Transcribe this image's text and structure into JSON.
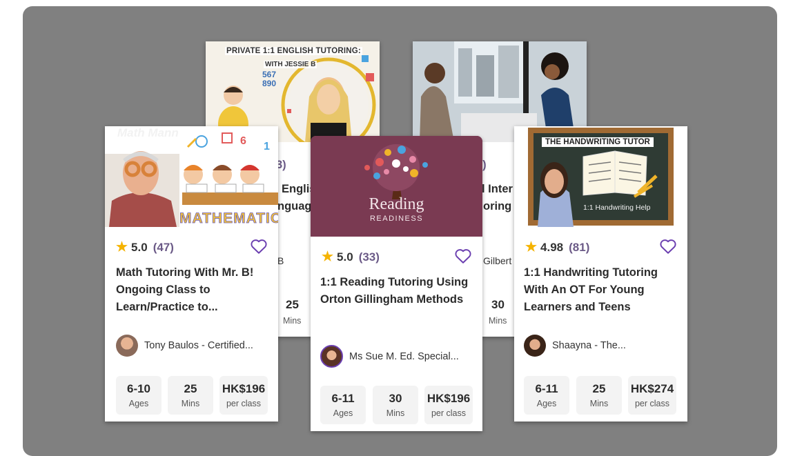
{
  "back_cards": {
    "english": {
      "banner_line1": "PRIVATE 1:1 ENGLISH TUTORING:",
      "banner_line2": "WITH JESSIE B",
      "number_strip": "567\n890",
      "count_fragment": "3)",
      "title_line1": "Englis",
      "title_line2": "nguag",
      "teacher_fragment": "B",
      "mins_value": "25",
      "mins_label": "Mins"
    },
    "interview": {
      "count_fragment": "0)",
      "title_line1": "l Inter",
      "title_line2": "oring",
      "teacher_fragment": "Gilbert",
      "mins_value": "30",
      "mins_label": "Mins"
    }
  },
  "cards": [
    {
      "image_text": "MATHEMATICS",
      "logo_text": "Math Mann",
      "rating": "5.0",
      "reviews": "(47)",
      "title": [
        "Math Tutoring With Mr. B!",
        "Ongoing Class to",
        "Learn/Practice to..."
      ],
      "teacher": "Tony Baulos - Certified...",
      "stats": [
        {
          "value": "6-10",
          "label": "Ages"
        },
        {
          "value": "25",
          "label": "Mins"
        },
        {
          "value": "HK$196",
          "label": "per class"
        }
      ]
    },
    {
      "image_text": "Reading",
      "image_subtext": "READINESS",
      "rating": "5.0",
      "reviews": "(33)",
      "title": [
        "1:1 Reading Tutoring Using",
        "Orton Gillingham Methods"
      ],
      "teacher": "Ms Sue M. Ed. Special...",
      "stats": [
        {
          "value": "6-11",
          "label": "Ages"
        },
        {
          "value": "30",
          "label": "Mins"
        },
        {
          "value": "HK$196",
          "label": "per class"
        }
      ]
    },
    {
      "image_text": "THE HANDWRITING TUTOR",
      "image_subtext": "1:1 Handwriting Help",
      "rating": "4.98",
      "reviews": "(81)",
      "title": [
        "1:1 Handwriting Tutoring",
        "With An OT For Young",
        "Learners and Teens"
      ],
      "teacher": "Shaayna - The...",
      "stats": [
        {
          "value": "6-11",
          "label": "Ages"
        },
        {
          "value": "25",
          "label": "Mins"
        },
        {
          "value": "HK$274",
          "label": "per class"
        }
      ]
    }
  ],
  "icons": {
    "star": "star-icon",
    "heart": "heart-icon"
  },
  "colors": {
    "background_panel": "#808080",
    "reading_banner": "#7a3a52",
    "star": "#f5b301",
    "heart": "#6b3fb0",
    "review_count": "#6b5a87",
    "chalkboard": "#2f3b34",
    "frame": "#a06a33"
  }
}
